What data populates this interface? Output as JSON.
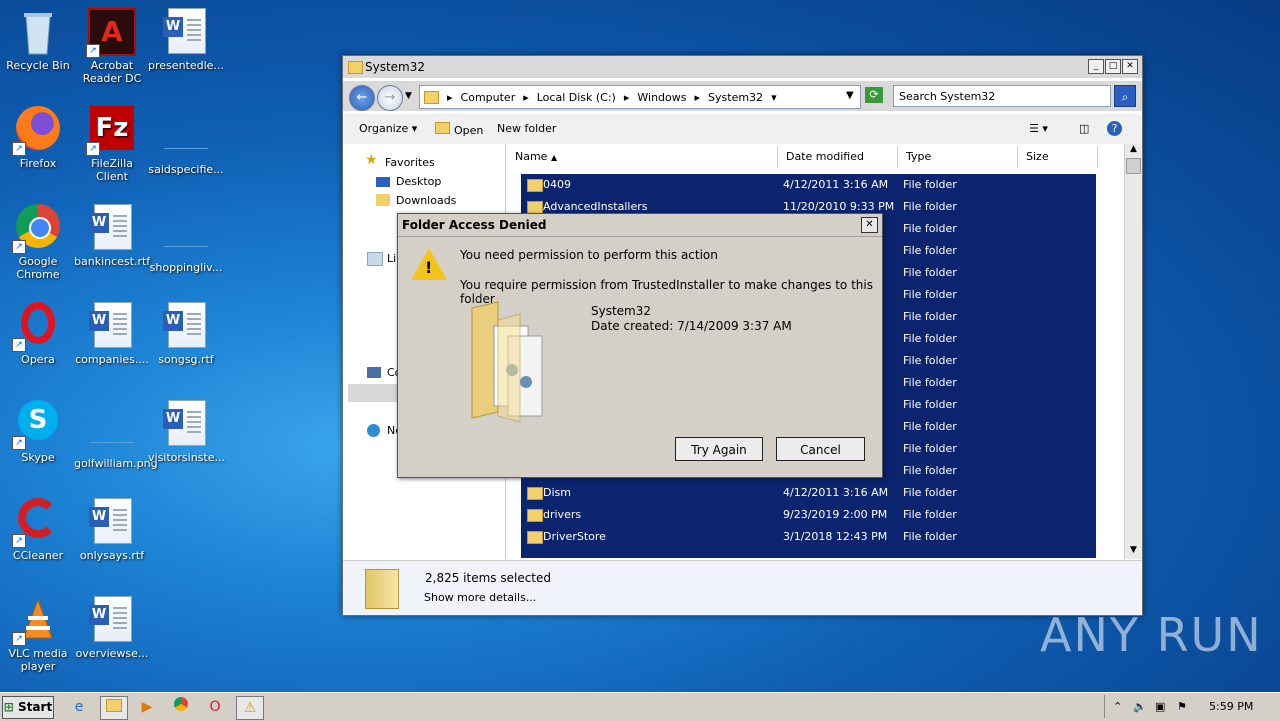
{
  "desktop": {
    "icons": [
      {
        "label": "Recycle Bin"
      },
      {
        "label": "Acrobat Reader DC"
      },
      {
        "label": "presentedle..."
      },
      {
        "label": "Firefox"
      },
      {
        "label": "FileZilla Client"
      },
      {
        "label": "saidspecifie..."
      },
      {
        "label": "Google Chrome"
      },
      {
        "label": "bankincest.rtf"
      },
      {
        "label": "shoppingliv..."
      },
      {
        "label": "Opera"
      },
      {
        "label": "companies...."
      },
      {
        "label": "songsg.rtf"
      },
      {
        "label": "Skype"
      },
      {
        "label": "golfwilliam.png"
      },
      {
        "label": "visitorsinste..."
      },
      {
        "label": "CCleaner"
      },
      {
        "label": "onlysays.rtf"
      },
      {
        "label": "VLC media player"
      },
      {
        "label": "overviewse..."
      }
    ]
  },
  "explorer": {
    "title": "System32",
    "breadcrumb": [
      "Computer",
      "Local Disk (C:)",
      "Windows",
      "System32"
    ],
    "search_placeholder": "Search System32",
    "toolbar": {
      "organize": "Organize",
      "open": "Open",
      "new_folder": "New folder"
    },
    "nav": {
      "favorites": "Favorites",
      "desktop": "Desktop",
      "downloads": "Downloads",
      "libraries": "Lib",
      "computer": "Co",
      "network": "Ne"
    },
    "columns": {
      "name": "Name",
      "date": "Date modified",
      "type": "Type",
      "size": "Size"
    },
    "rows": [
      {
        "name": "0409",
        "date": "4/12/2011 3:16 AM",
        "type": "File folder"
      },
      {
        "name": "AdvancedInstallers",
        "date": "11/20/2010 9:33 PM",
        "type": "File folder"
      },
      {
        "name": "",
        "date": "",
        "type": "File folder"
      },
      {
        "name": "",
        "date": "",
        "type": "File folder"
      },
      {
        "name": "",
        "date": "",
        "type": "File folder"
      },
      {
        "name": "",
        "date": "",
        "type": "File folder"
      },
      {
        "name": "",
        "date": "",
        "type": "File folder"
      },
      {
        "name": "",
        "date": "",
        "type": "File folder"
      },
      {
        "name": "",
        "date": "",
        "type": "File folder"
      },
      {
        "name": "",
        "date": "",
        "type": "File folder"
      },
      {
        "name": "",
        "date": "",
        "type": "File folder"
      },
      {
        "name": "",
        "date": "",
        "type": "File folder"
      },
      {
        "name": "",
        "date": "",
        "type": "File folder"
      },
      {
        "name": "",
        "date": "",
        "type": "File folder"
      },
      {
        "name": "Dism",
        "date": "4/12/2011 3:16 AM",
        "type": "File folder"
      },
      {
        "name": "drivers",
        "date": "9/23/2019 2:00 PM",
        "type": "File folder"
      },
      {
        "name": "DriverStore",
        "date": "3/1/2018 12:43 PM",
        "type": "File folder"
      }
    ],
    "details": {
      "count": "2,825 items selected",
      "more": "Show more details..."
    }
  },
  "dialog": {
    "title": "Folder Access Denied",
    "line1": "You need permission to perform this action",
    "line2": "You require permission from TrustedInstaller to make changes to this folder",
    "folder_name": "System32",
    "folder_date": "Date created: 7/14/2009 3:37 AM",
    "try_again": "Try Again",
    "cancel": "Cancel"
  },
  "taskbar": {
    "start": "Start",
    "clock": "5:59 PM"
  },
  "watermark": "ANY RUN"
}
